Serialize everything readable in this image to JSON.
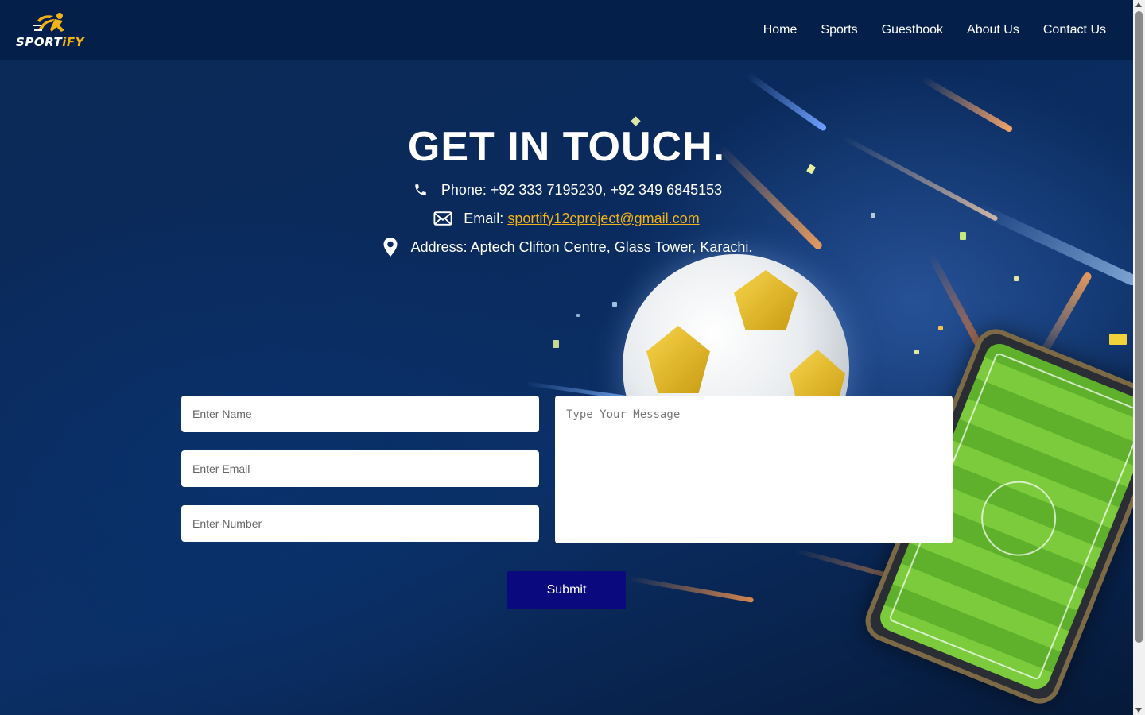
{
  "brand": {
    "logo_text_main": "SPORT",
    "logo_text_accent": "iFY",
    "accent_color": "#f3b316"
  },
  "nav": {
    "items": [
      {
        "label": "Home"
      },
      {
        "label": "Sports"
      },
      {
        "label": "Guestbook"
      },
      {
        "label": "About Us"
      },
      {
        "label": "Contact Us"
      }
    ]
  },
  "contact": {
    "title": "GET IN TOUCH.",
    "phone": "Phone: +92 333 7195230, +92 349 6845153",
    "email_label": "Email:",
    "email_address": "sportify12cproject@gmail.com",
    "address": "Address: Aptech Clifton Centre, Glass Tower, Karachi.",
    "icons": [
      "phone-icon",
      "envelope-icon",
      "map-pin-icon"
    ]
  },
  "form": {
    "name_placeholder": "Enter Name",
    "email_placeholder": "Enter Email",
    "number_placeholder": "Enter Number",
    "message_placeholder": "Type Your Message",
    "submit_label": "Submit",
    "submit_color": "#0a0a7e"
  }
}
